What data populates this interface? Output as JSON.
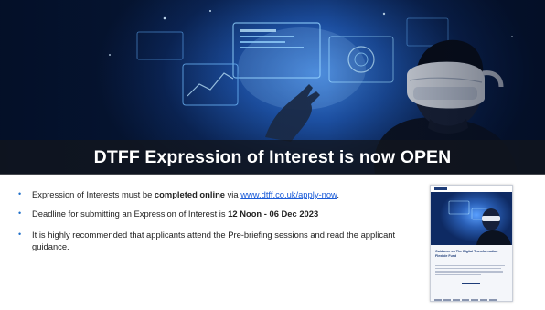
{
  "slide": {
    "title": "DTFF Expression of Interest is now OPEN"
  },
  "bullets": {
    "b1": {
      "prefix": "Expression of Interests must be ",
      "bold": "completed online",
      "middle": " via ",
      "link": "www.dtff.co.uk/apply-now",
      "suffix": "."
    },
    "b2": {
      "prefix": "Deadline for submitting an Expression of Interest is ",
      "bold": "12 Noon -  06 Dec 2023"
    },
    "b3": {
      "text": "It is highly recommended that applicants attend the Pre-briefing sessions and read the applicant guidance."
    }
  },
  "thumbnail": {
    "title": "Guidance on The Digital Transformation Flexible Fund"
  },
  "colors": {
    "accent": "#1f6fc9",
    "link": "#1a5bd8",
    "title_band": "#12161e"
  },
  "icons": {
    "bullet": "bullet-dot-icon"
  }
}
